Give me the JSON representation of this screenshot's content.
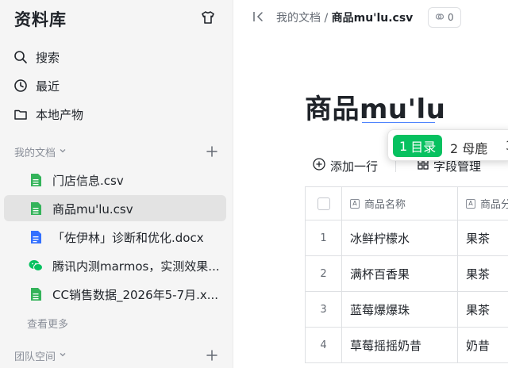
{
  "sidebar": {
    "title": "资料库",
    "nav": [
      {
        "label": "搜索",
        "icon": "search-icon"
      },
      {
        "label": "最近",
        "icon": "clock-icon"
      },
      {
        "label": "本地产物",
        "icon": "folder-icon"
      }
    ],
    "my_docs": {
      "label": "我的文档",
      "items": [
        {
          "label": "门店信息.csv",
          "icon": "sheet-icon",
          "color": "#34b35a"
        },
        {
          "label": "商品mu'lu.csv",
          "icon": "sheet-icon",
          "color": "#34b35a",
          "active": true
        },
        {
          "label": "「佐伊林」诊断和优化.docx",
          "icon": "doc-icon",
          "color": "#3370ff"
        },
        {
          "label": "腾讯内测marmos，实测效果...",
          "icon": "wechat-icon",
          "color": "#07c160"
        },
        {
          "label": "CC销售数据_2026年5-7月.x...",
          "icon": "sheet-icon",
          "color": "#34b35a"
        }
      ],
      "more": "查看更多"
    },
    "team_space": {
      "label": "团队空间"
    }
  },
  "topbar": {
    "breadcrumb_parent": "我的文档",
    "breadcrumb_sep": "/",
    "breadcrumb_current": "商品mu'lu.csv",
    "badge_count": "0"
  },
  "page": {
    "title": "商品mu'lu"
  },
  "ime": {
    "candidates": [
      {
        "index": "1",
        "text": "目录"
      },
      {
        "index": "2",
        "text": "母鹿"
      },
      {
        "index": "3",
        "text": ""
      }
    ],
    "highlight_color": "#07c160"
  },
  "toolbar": {
    "add_row": "添加一行",
    "field_manage": "字段管理"
  },
  "table": {
    "columns": [
      "商品名称",
      "商品分"
    ],
    "rows": [
      {
        "num": "1",
        "name": "冰鲜柠檬水",
        "category": "果茶"
      },
      {
        "num": "2",
        "name": "满杯百香果",
        "category": "果茶"
      },
      {
        "num": "3",
        "name": "蓝莓爆爆珠",
        "category": "果茶"
      },
      {
        "num": "4",
        "name": "草莓摇摇奶昔",
        "category": "奶昔"
      }
    ]
  }
}
